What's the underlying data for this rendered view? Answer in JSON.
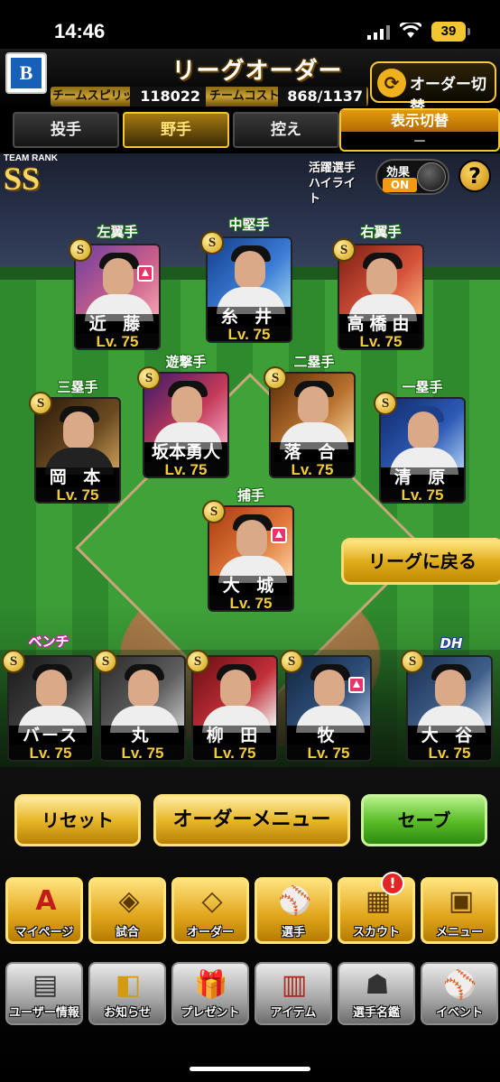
{
  "status_bar": {
    "time": "14:46",
    "battery": "39"
  },
  "header": {
    "logo_text": "B",
    "title": "リーグオーダー",
    "team_spirits_label": "チームスピリッツ",
    "team_spirits_value": "118022",
    "team_cost_label": "チームコスト",
    "team_cost_value": "868/1137",
    "order_switch_label": "オーダー切替",
    "order_switch_icon": "refresh-arrows-icon"
  },
  "tabs": [
    {
      "label": "投手",
      "active": false
    },
    {
      "label": "野手",
      "active": true
    },
    {
      "label": "控え",
      "active": false
    }
  ],
  "display_toggle": {
    "label": "表示切替",
    "value": "－"
  },
  "team_rank": {
    "label": "TEAM RANK",
    "value": "SS"
  },
  "highlight": {
    "label": "活躍選手ハイライト",
    "effect_label": "効果",
    "effect_state": "ON"
  },
  "help_label": "?",
  "badge_text": "S",
  "positions": {
    "left_field": {
      "label": "左翼手",
      "name": "近 藤",
      "level": "Lv. 75",
      "accent": "#c95f8a"
    },
    "center_field": {
      "label": "中堅手",
      "name": "糸 井",
      "level": "Lv. 75",
      "accent": "#3a7bd5"
    },
    "right_field": {
      "label": "右翼手",
      "name": "高橋由",
      "level": "Lv. 75",
      "accent": "#d6523b"
    },
    "third_base": {
      "label": "三塁手",
      "name": "岡 本",
      "level": "Lv. 75",
      "accent": "#6b4a22"
    },
    "shortstop": {
      "label": "遊撃手",
      "name": "坂本勇人",
      "level": "Lv. 75",
      "accent": "#c43a58"
    },
    "second_base": {
      "label": "二塁手",
      "name": "落 合",
      "level": "Lv. 75",
      "accent": "#b9722f"
    },
    "first_base": {
      "label": "一塁手",
      "name": "清 原",
      "level": "Lv. 75",
      "accent": "#2e5ab5"
    },
    "catcher": {
      "label": "捕手",
      "name": "大 城",
      "level": "Lv. 75",
      "accent": "#e17a3a"
    }
  },
  "back_to_league": "リーグに戻る",
  "bench": {
    "label": "ベンチ",
    "dh_label": "DH",
    "players": [
      {
        "name": "バース",
        "level": "Lv. 75",
        "accent": "#3f3f3f"
      },
      {
        "name": "丸",
        "level": "Lv. 75",
        "accent": "#5e5e5e"
      },
      {
        "name": "柳 田",
        "level": "Lv. 75",
        "accent": "#c2303a"
      },
      {
        "name": "牧",
        "level": "Lv. 75",
        "accent": "#2f4f7a"
      },
      {
        "name": "大 谷",
        "level": "Lv. 75",
        "accent": "#3f5f8a"
      }
    ]
  },
  "actions": {
    "reset": "リセット",
    "order_menu": "オーダーメニュー",
    "save": "セーブ"
  },
  "main_nav": [
    {
      "label": "マイページ",
      "icon": "a-emblem-icon",
      "glyph": "A"
    },
    {
      "label": "試合",
      "icon": "stadium-icon",
      "glyph": "◈"
    },
    {
      "label": "オーダー",
      "icon": "diamond-field-icon",
      "glyph": "◇"
    },
    {
      "label": "選手",
      "icon": "player-pitching-icon",
      "glyph": "⚾"
    },
    {
      "label": "スカウト",
      "icon": "scout-cards-icon",
      "glyph": "▦"
    },
    {
      "label": "メニュー",
      "icon": "menu-character-icon",
      "glyph": "▣"
    }
  ],
  "scout_notification": "!",
  "sub_nav": [
    {
      "label": "ユーザー情報",
      "icon": "user-card-icon",
      "glyph": "▤"
    },
    {
      "label": "お知らせ",
      "icon": "mascot-notice-icon",
      "glyph": "◧"
    },
    {
      "label": "プレゼント",
      "icon": "gift-box-icon",
      "glyph": "🎁"
    },
    {
      "label": "アイテム",
      "icon": "items-icon",
      "glyph": "▥"
    },
    {
      "label": "選手名鑑",
      "icon": "player-book-icon",
      "glyph": "☗"
    },
    {
      "label": "イベント",
      "icon": "bat-ball-icon",
      "glyph": "⚾"
    }
  ]
}
